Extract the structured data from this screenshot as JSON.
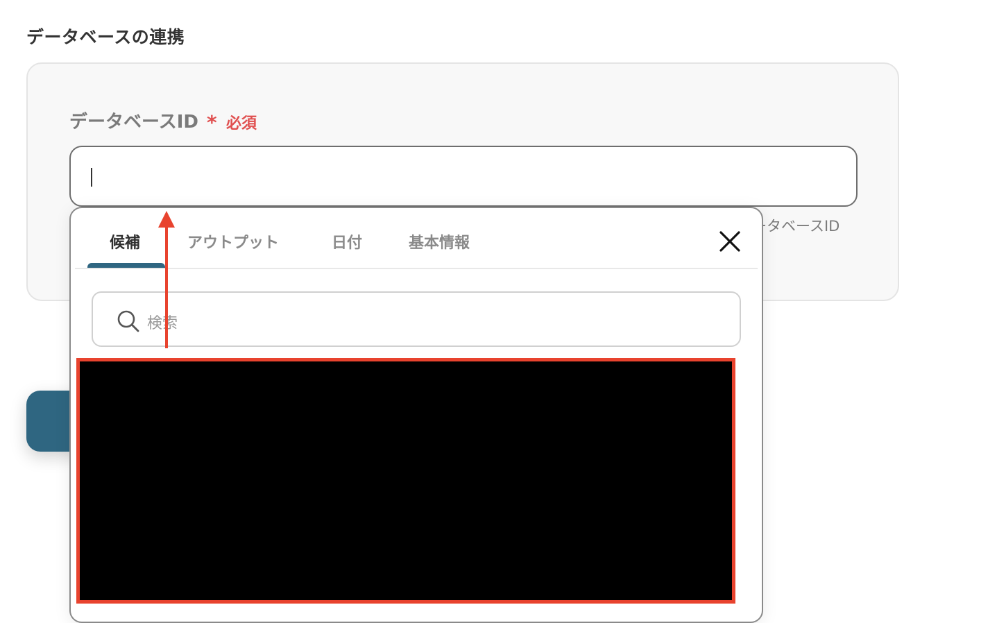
{
  "section": {
    "title": "データベースの連携"
  },
  "field": {
    "label": "データベースID",
    "required_star": "*",
    "required_text": "必須",
    "value": "",
    "help_text": "ータベースID"
  },
  "dropdown": {
    "tabs": [
      {
        "label": "候補",
        "active": true
      },
      {
        "label": "アウトプット",
        "active": false
      },
      {
        "label": "日付",
        "active": false
      },
      {
        "label": "基本情報",
        "active": false
      }
    ],
    "search_placeholder": "検索",
    "close_icon": "close-icon",
    "search_icon": "search-icon"
  },
  "colors": {
    "accent": "#2f6681",
    "required": "#e04f4f",
    "annotation": "#e8432e",
    "redaction": "#000000"
  }
}
